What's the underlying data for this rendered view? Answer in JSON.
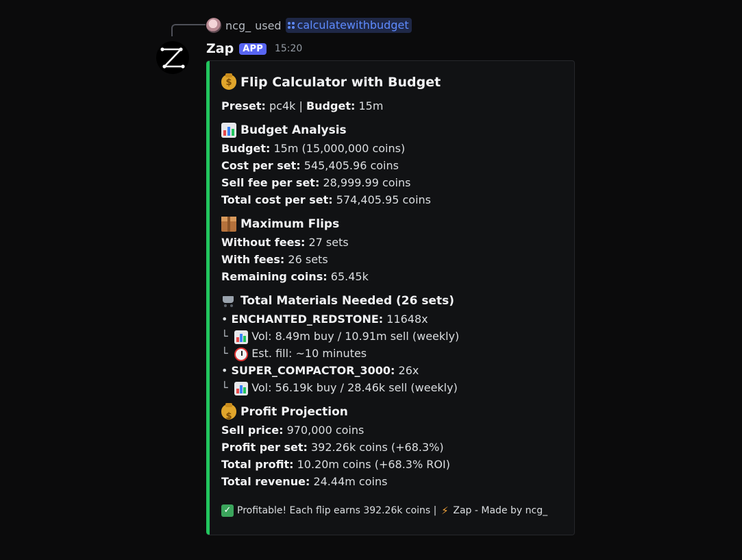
{
  "command": {
    "user": "ncg_",
    "used_text": "used",
    "command_name": "calculatewithbudget",
    "avatar_icon": "user-avatar",
    "command_icon": "slash-command-icon"
  },
  "bot": {
    "name": "Zap",
    "badge": "APP",
    "timestamp": "15:20",
    "avatar_icon": "zap-logo"
  },
  "embed": {
    "accent_color": "#22c55e",
    "title": "Flip Calculator with Budget",
    "preset_label": "Preset:",
    "preset_value": "pc4k",
    "separator": "|",
    "budget_label": "Budget:",
    "budget_value": "15m",
    "sections": {
      "budget_analysis": {
        "title": "Budget Analysis",
        "lines": [
          {
            "label": "Budget:",
            "value": "15m (15,000,000 coins)"
          },
          {
            "label": "Cost per set:",
            "value": "545,405.96 coins"
          },
          {
            "label": "Sell fee per set:",
            "value": "28,999.99 coins"
          },
          {
            "label": "Total cost per set:",
            "value": "574,405.95 coins"
          }
        ]
      },
      "maximum_flips": {
        "title": "Maximum Flips",
        "lines": [
          {
            "label": "Without fees:",
            "value": "27 sets"
          },
          {
            "label": "With fees:",
            "value": "26 sets"
          },
          {
            "label": "Remaining coins:",
            "value": "65.45k"
          }
        ]
      },
      "materials": {
        "title": "Total Materials Needed (26 sets)",
        "bullet": "•",
        "branch": "└",
        "item1_name": "ENCHANTED_REDSTONE:",
        "item1_qty": "11648x",
        "item1_vol": "Vol: 8.49m buy / 10.91m sell (weekly)",
        "item1_fill": "Est. fill: ~10 minutes",
        "item2_name": "SUPER_COMPACTOR_3000:",
        "item2_qty": "26x",
        "item2_vol": "Vol: 56.19k buy / 28.46k sell (weekly)"
      },
      "profit": {
        "title": "Profit Projection",
        "lines": [
          {
            "label": "Sell price:",
            "value": "970,000 coins"
          },
          {
            "label": "Profit per set:",
            "value": "392.26k coins (+68.3%)"
          },
          {
            "label": "Total profit:",
            "value": "10.20m coins (+68.3% ROI)"
          },
          {
            "label": "Total revenue:",
            "value": "24.44m coins"
          }
        ]
      }
    },
    "footer": {
      "text": "Profitable! Each flip earns 392.26k coins |",
      "credit": "Zap - Made by ncg_"
    }
  }
}
